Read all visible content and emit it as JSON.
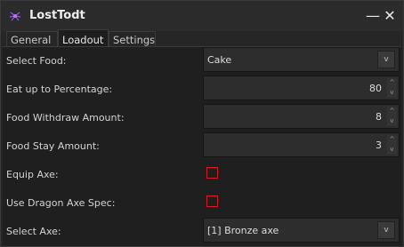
{
  "window": {
    "title": "LostTodt",
    "minimize": "—",
    "close": "✕",
    "icon": "purple-spider-icon"
  },
  "tabs": [
    {
      "label": "General",
      "active": false
    },
    {
      "label": "Loadout",
      "active": true
    },
    {
      "label": "Settings",
      "active": false
    }
  ],
  "form": {
    "select_food": {
      "label": "Select Food:",
      "value": "Cake"
    },
    "eat_percentage": {
      "label": "Eat up to Percentage:",
      "value": "80"
    },
    "food_withdraw": {
      "label": "Food Withdraw Amount:",
      "value": "8"
    },
    "food_stay": {
      "label": "Food Stay Amount:",
      "value": "3"
    },
    "equip_axe": {
      "label": "Equip Axe:",
      "checked": false
    },
    "dragon_axe_spec": {
      "label": "Use Dragon Axe Spec:",
      "checked": false
    },
    "select_axe": {
      "label": "Select Axe:",
      "value": "[1] Bronze axe"
    }
  },
  "glyphs": {
    "dropdown": "v",
    "up": "^",
    "down": "v"
  },
  "colors": {
    "checkbox_border": "#d21a2a",
    "panel_bg": "#1f1f1f"
  }
}
